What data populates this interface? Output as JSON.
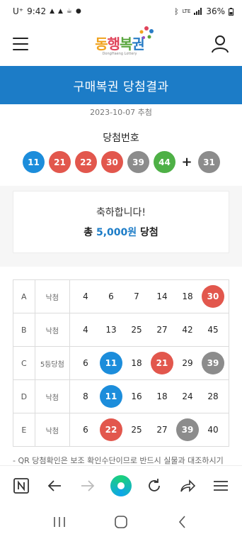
{
  "status_bar": {
    "carrier": "U⁺",
    "time": "9:42",
    "network": "LTE",
    "battery": "36%"
  },
  "header": {
    "logo_text": [
      "동",
      "행",
      "복",
      "권"
    ],
    "logo_subtitle": "DongHaeng Lottery"
  },
  "banner": {
    "title": "구매복권 당첨결과"
  },
  "draw": {
    "date": "2023-10-07 추첨",
    "numbers_title": "당첨번호",
    "numbers": [
      {
        "n": "11",
        "color": "#1c8ddb"
      },
      {
        "n": "21",
        "color": "#e2574d"
      },
      {
        "n": "22",
        "color": "#e2574d"
      },
      {
        "n": "30",
        "color": "#e2574d"
      },
      {
        "n": "39",
        "color": "#8c8c8c"
      },
      {
        "n": "44",
        "color": "#4eb046"
      }
    ],
    "plus": "+",
    "bonus": {
      "n": "31",
      "color": "#8c8c8c"
    }
  },
  "congrats": {
    "message": "축하합니다!",
    "prize_prefix": "총",
    "prize_amount": "5,000원",
    "prize_suffix": "당첨"
  },
  "results": [
    {
      "label": "A",
      "result": "낙첨",
      "nums": [
        {
          "n": "4"
        },
        {
          "n": "6"
        },
        {
          "n": "7"
        },
        {
          "n": "14"
        },
        {
          "n": "18"
        },
        {
          "n": "30",
          "color": "#e2574d"
        }
      ]
    },
    {
      "label": "B",
      "result": "낙첨",
      "nums": [
        {
          "n": "4"
        },
        {
          "n": "13"
        },
        {
          "n": "25"
        },
        {
          "n": "27"
        },
        {
          "n": "42"
        },
        {
          "n": "45"
        }
      ]
    },
    {
      "label": "C",
      "result": "5등당첨",
      "nums": [
        {
          "n": "6"
        },
        {
          "n": "11",
          "color": "#1c8ddb"
        },
        {
          "n": "18"
        },
        {
          "n": "21",
          "color": "#e2574d"
        },
        {
          "n": "29"
        },
        {
          "n": "39",
          "color": "#8c8c8c"
        }
      ]
    },
    {
      "label": "D",
      "result": "낙첨",
      "nums": [
        {
          "n": "8"
        },
        {
          "n": "11",
          "color": "#1c8ddb"
        },
        {
          "n": "16"
        },
        {
          "n": "18"
        },
        {
          "n": "24"
        },
        {
          "n": "28"
        }
      ]
    },
    {
      "label": "E",
      "result": "낙첨",
      "nums": [
        {
          "n": "6"
        },
        {
          "n": "22",
          "color": "#e2574d"
        },
        {
          "n": "25"
        },
        {
          "n": "27"
        },
        {
          "n": "39",
          "color": "#8c8c8c"
        },
        {
          "n": "40"
        }
      ]
    }
  ],
  "note": "- QR 당첨확인은 보조 확인수단이므로 반드시 실물과 대조하시기",
  "toolbar": {
    "icons": [
      "naver-icon",
      "back-arrow-icon",
      "forward-arrow-icon",
      "home-icon",
      "refresh-icon",
      "share-icon",
      "menu-icon"
    ]
  },
  "navbar": {
    "icons": [
      "recent-apps-icon",
      "home-icon",
      "back-icon"
    ]
  }
}
